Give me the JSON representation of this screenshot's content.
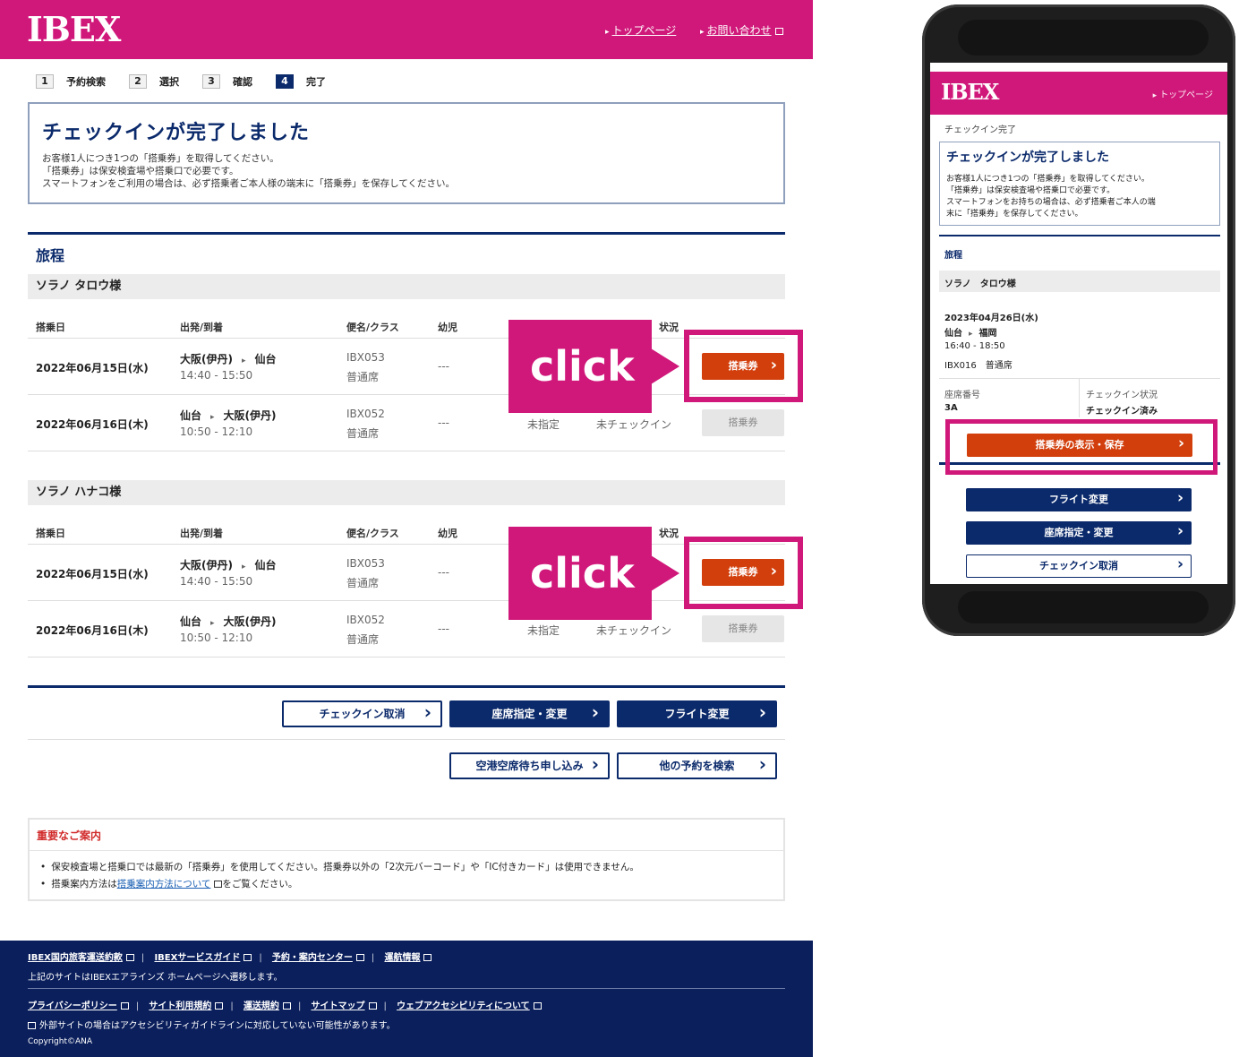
{
  "header": {
    "logo": "IBEX",
    "top_link": "トップページ",
    "contact_link": "お問い合わせ"
  },
  "steps": [
    {
      "num": "1",
      "label": "予約検索"
    },
    {
      "num": "2",
      "label": "選択"
    },
    {
      "num": "3",
      "label": "確認"
    },
    {
      "num": "4",
      "label": "完了"
    }
  ],
  "done": {
    "title": "チェックインが完了しました",
    "line1": "お客様1人につき1つの「搭乗券」を取得してください。",
    "line2": "「搭乗券」は保安検査場や搭乗口で必要です。",
    "line3": "スマートフォンをご利用の場合は、必ず搭乗者ご本人様の端末に「搭乗券」を保存してください。"
  },
  "itinerary": {
    "title": "旅程",
    "columns": {
      "date": "搭乗日",
      "route": "出発/到着",
      "flight": "便名/クラス",
      "infant": "幼児",
      "status": "状況"
    },
    "passengers": [
      {
        "name": "ソラノ タロウ様",
        "flights": [
          {
            "date": "2022年06月15日(水)",
            "from": "大阪(伊丹)",
            "to": "仙台",
            "time": "14:40 - 15:50",
            "flight_no": "IBX053",
            "class": "普通席",
            "infant": "---",
            "seat": "",
            "checkin": "",
            "button": "搭乗券"
          },
          {
            "date": "2022年06月16日(木)",
            "from": "仙台",
            "to": "大阪(伊丹)",
            "time": "10:50 - 12:10",
            "flight_no": "IBX052",
            "class": "普通席",
            "infant": "---",
            "seat": "未指定",
            "checkin": "未チェックイン",
            "button": "搭乗券"
          }
        ]
      },
      {
        "name": "ソラノ ハナコ様",
        "flights": [
          {
            "date": "2022年06月15日(水)",
            "from": "大阪(伊丹)",
            "to": "仙台",
            "time": "14:40 - 15:50",
            "flight_no": "IBX053",
            "class": "普通席",
            "infant": "---",
            "seat": "",
            "checkin": "",
            "button": "搭乗券"
          },
          {
            "date": "2022年06月16日(木)",
            "from": "仙台",
            "to": "大阪(伊丹)",
            "time": "10:50 - 12:10",
            "flight_no": "IBX052",
            "class": "普通席",
            "infant": "---",
            "seat": "未指定",
            "checkin": "未チェックイン",
            "button": "搭乗券"
          }
        ]
      }
    ]
  },
  "callout": {
    "text": "click"
  },
  "actions": {
    "cancel_checkin": "チェックイン取消",
    "seat_change": "座席指定・変更",
    "flight_change": "フライト変更",
    "standby": "空港空席待ち申し込み",
    "search_other": "他の予約を検索"
  },
  "notice": {
    "title": "重要なご案内",
    "item1": "保安検査場と搭乗口では最新の「搭乗券」を使用してください。搭乗券以外の「2次元バーコード」や「IC付きカード」は使用できません。",
    "item2_pre": "搭乗案内方法は",
    "item2_link": "搭乗案内方法について",
    "item2_post": "をご覧ください。"
  },
  "footer": {
    "row1": [
      "IBEX国内旅客運送約款",
      "IBEXサービスガイド",
      "予約・案内センター",
      "運航情報"
    ],
    "note1": "上記のサイトはIBEXエアラインズ ホームページへ遷移します。",
    "row2": [
      "プライバシーポリシー",
      "サイト利用規約",
      "運送規約",
      "サイトマップ",
      "ウェブアクセシビリティについて"
    ],
    "note2": "外部サイトの場合はアクセシビリティガイドラインに対応していない可能性があります。",
    "copyright": "Copyright©ANA"
  },
  "phone": {
    "logo": "IBEX",
    "top_link": "トップページ",
    "breadcrumb": "チェックイン完了",
    "title": "チェックインが完了しました",
    "line1": "お客様1人につき1つの「搭乗券」を取得してください。",
    "line2": "「搭乗券」は保安検査場や搭乗口で必要です。",
    "line3": "スマートフォンをお持ちの場合は、必ず搭乗者ご本人の端",
    "line4": "末に「搭乗券」を保存してください。",
    "itin_title": "旅程",
    "passenger": "ソラノ　タロウ様",
    "date": "2023年04月26日(水)",
    "from": "仙台",
    "to": "福岡",
    "time": "16:40 - 18:50",
    "flight": "IBX016　普通席",
    "seat_label": "座席番号",
    "seat_value": "3A",
    "status_label": "チェックイン状況",
    "status_value": "チェックイン済み",
    "ticket_button": "搭乗券の表示・保存",
    "flight_change": "フライト変更",
    "seat_change": "座席指定・変更",
    "cancel_checkin": "チェックイン取消"
  },
  "colors": {
    "brand": "#d0187a",
    "navy": "#0b2a6b",
    "ticket": "#d23f0c"
  }
}
